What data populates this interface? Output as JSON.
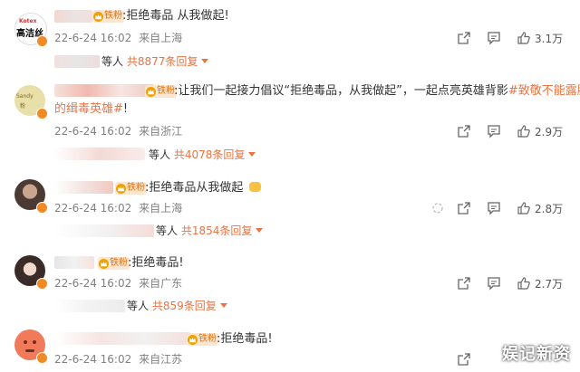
{
  "colors": {
    "accent": "#eb7340",
    "muted": "#808080",
    "badge_bg": "#fde6cf"
  },
  "comments": [
    {
      "avatar_text": "高洁丝",
      "badge_label": "铁粉",
      "text": ":拒绝毒品 从我做起!",
      "date": "22-6-24 16:02",
      "location": "来自上海",
      "likes": "3.1万",
      "reply_prefix": "等人",
      "reply_count": "共8877条回复"
    },
    {
      "avatar_text": "",
      "badge_label": "铁粉",
      "text": ":让我们一起接力倡议“拒绝毒品，从我做起”，一起点亮英雄背影",
      "hashtag": "#致敬不能露脸",
      "text_line2": "的缉毒英雄#",
      "text_line2_suffix": "!",
      "date": "22-6-24 16:02",
      "location": "来自浙江",
      "likes": "2.9万",
      "reply_prefix": "等人",
      "reply_count": "共4078条回复"
    },
    {
      "avatar_text": "",
      "badge_label": "铁粉",
      "text": ":拒绝毒品从我做起",
      "date": "22-6-24 16:02",
      "location": "来自上海",
      "likes": "2.8万",
      "reply_prefix": "等人",
      "reply_count": "共1854条回复"
    },
    {
      "avatar_text": "",
      "badge_label": "铁粉",
      "text": ":拒绝毒品!",
      "date": "22-6-24 16:02",
      "location": "来自广东",
      "likes": "2.7万",
      "reply_prefix": "等人",
      "reply_count": "共859条回复"
    },
    {
      "avatar_text": "",
      "badge_label": "铁粉",
      "text": ":拒绝毒品!",
      "date": "22-6-24 16:02",
      "location": "来自江苏",
      "likes": "",
      "reply_prefix": "",
      "reply_count": ""
    }
  ],
  "watermark": "娱记新资",
  "icons": {
    "share": "share-icon",
    "comment": "comment-icon",
    "like": "thumbs-up-icon"
  }
}
